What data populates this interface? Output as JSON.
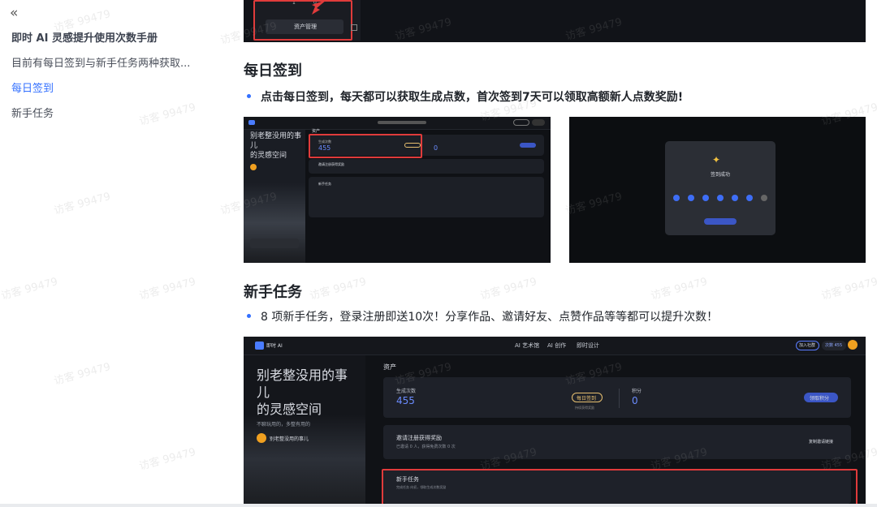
{
  "sidebar": {
    "collapse_icon": "«",
    "title": "即时 AI 灵感提升使用次数手册",
    "items": [
      {
        "label": "目前有每日签到与新手任务两种获取..."
      },
      {
        "label": "每日签到"
      },
      {
        "label": "新手任务"
      }
    ]
  },
  "watermark": "访客 99479",
  "top_shot": {
    "button_label": "资产管理"
  },
  "section_daily": {
    "heading": "每日签到",
    "bullet": "点击每日签到，每天都可以获取生成点数，首次签到7天可以领取高额新人点数奖励!",
    "left_shot": {
      "hero": [
        "别老整没用的事",
        "儿",
        "的灵感空间"
      ],
      "asset_label": "资产",
      "count_label": "生成次数",
      "count_value": "455",
      "points_value": "0",
      "invite": "邀请注册获得奖励",
      "tasks": "新手任务"
    },
    "right_shot": {
      "success": "签到成功"
    }
  },
  "section_tasks": {
    "heading": "新手任务",
    "bullet": "8 项新手任务，登录注册即送10次！分享作品、邀请好友、点赞作品等等都可以提升次数！",
    "shot": {
      "logo": "即时 AI",
      "nav": [
        "AI 艺术馆",
        "AI 创作",
        "即时设计"
      ],
      "invite_btn": "加入社群",
      "count_chip": "次数 455",
      "hero": [
        "别老整没用的事",
        "儿",
        "的灵感空间"
      ],
      "tagline": "不聊玩用的，多整有用的",
      "badge": "别老整没用的事儿",
      "asset_label": "资产",
      "count_label": "生成次数",
      "count_value": "455",
      "signin_btn": "每日签到",
      "signin_sub": "持续获得奖励",
      "points_label": "积分",
      "points_value": "0",
      "redeem_btn": "领取积分",
      "invite_title": "邀请注册获得奖励",
      "invite_sub": "已邀请 0 人，获得免费次数 0 次",
      "invite_action": "复制邀请链接",
      "tasks_title": "新手任务",
      "tasks_sub": "完成任务 向初，领取生成次数奖励"
    }
  }
}
